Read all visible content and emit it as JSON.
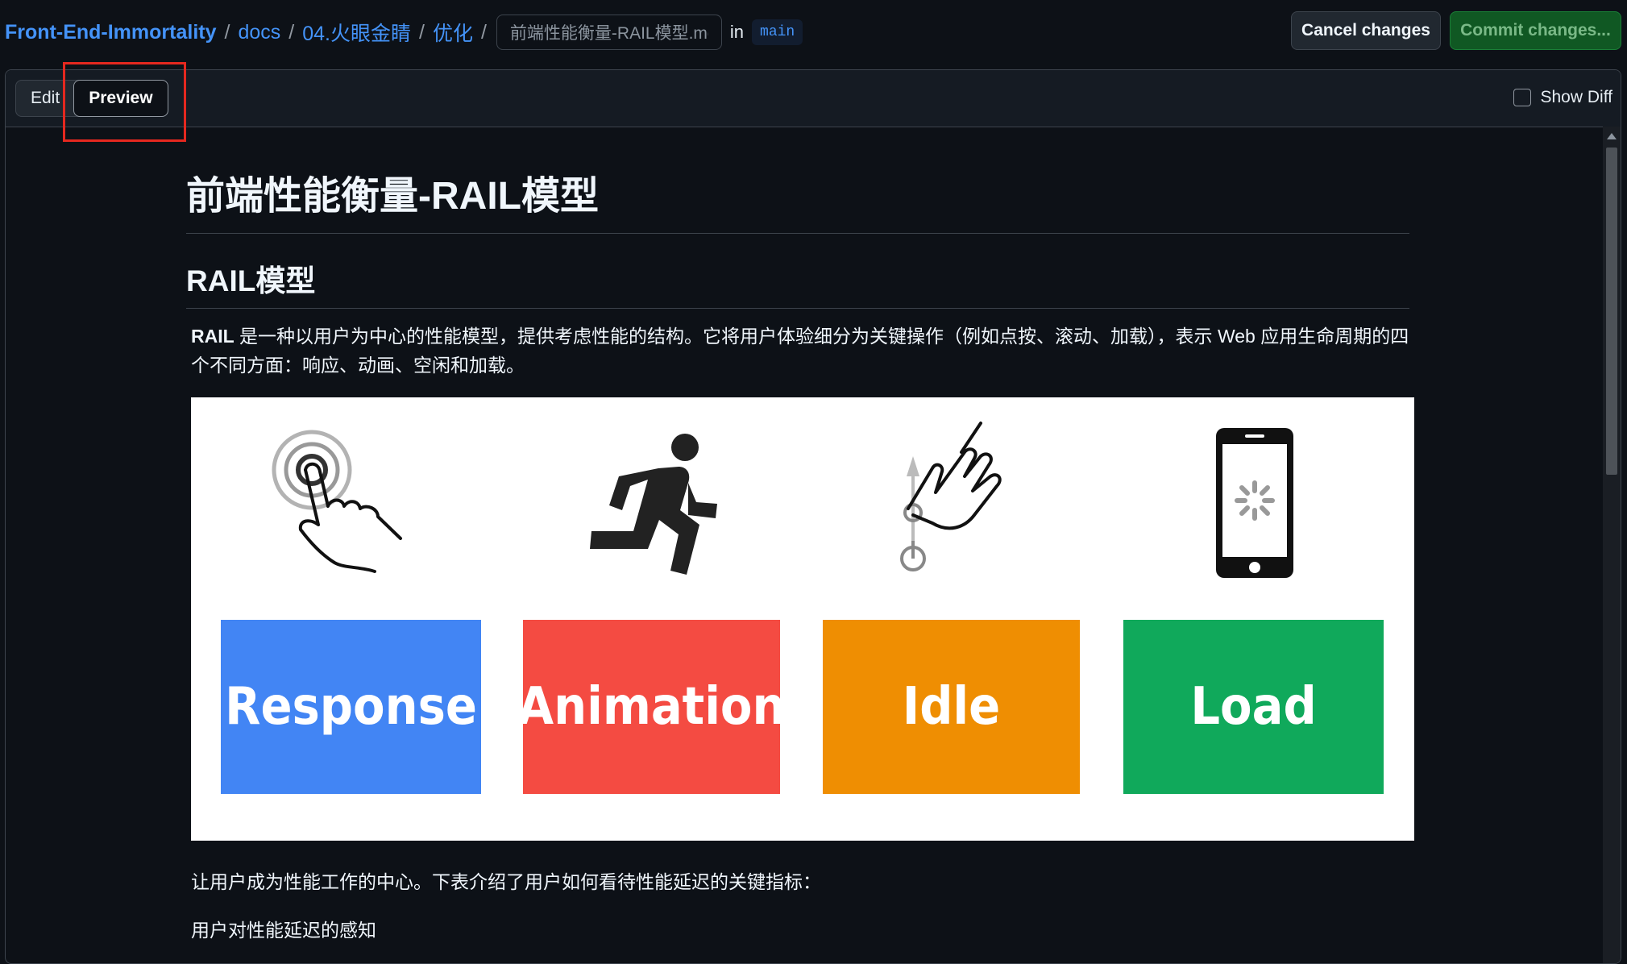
{
  "breadcrumb": {
    "repo": "Front-End-Immortality",
    "segments": [
      "docs",
      "04.火眼金睛",
      "优化"
    ],
    "separator": "/",
    "filename_value": "前端性能衡量-RAIL模型.md",
    "in_label": "in",
    "branch": "main"
  },
  "actions": {
    "cancel_label": "Cancel changes",
    "commit_label": "Commit changes..."
  },
  "editor": {
    "tabs": [
      {
        "label": "Edit",
        "active": false
      },
      {
        "label": "Preview",
        "active": true
      }
    ],
    "show_diff_label": "Show Diff",
    "show_diff_checked": false
  },
  "document": {
    "h1": "前端性能衡量-RAIL模型",
    "h2": "RAIL模型",
    "intro_strong": "RAIL",
    "intro_rest": " 是一种以用户为中心的性能模型，提供考虑性能的结构。它将用户体验细分为关键操作（例如点按、滚动、加载），表示 Web 应用生命周期的四个不同方面：响应、动画、空闲和加载。",
    "para2": "让用户成为性能工作的中心。下表介绍了用户如何看待性能延迟的关键指标：",
    "para3": "用户对性能延迟的感知"
  },
  "rail_image": {
    "cards": [
      {
        "label": "Response",
        "color": "#4285f4",
        "icon": "tap-hand-icon"
      },
      {
        "label": "Animation",
        "color": "#f44b42",
        "icon": "running-person-icon"
      },
      {
        "label": "Idle",
        "color": "#ef8e02",
        "icon": "swipe-hand-icon"
      },
      {
        "label": "Load",
        "color": "#10a95b",
        "icon": "phone-loading-icon"
      }
    ]
  },
  "colors": {
    "link": "#4493f8",
    "background": "#0d1117",
    "highlight": "#e5281f"
  }
}
